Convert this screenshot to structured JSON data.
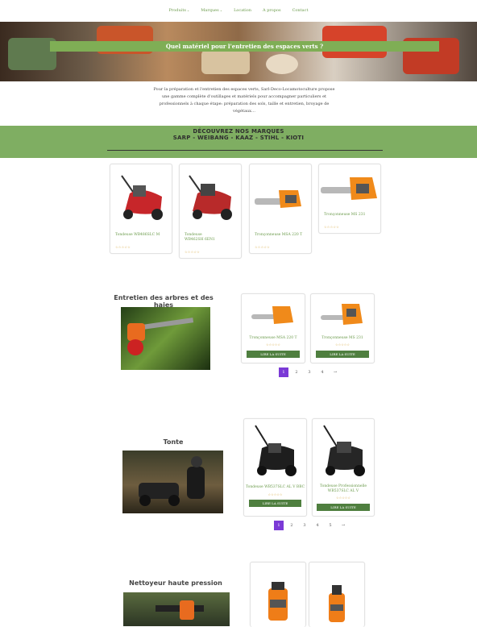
{
  "nav": {
    "items": [
      {
        "label": "Produits",
        "dropdown": true
      },
      {
        "label": "Marques",
        "dropdown": true
      },
      {
        "label": "Location",
        "dropdown": false
      },
      {
        "label": "A propos",
        "dropdown": false
      },
      {
        "label": "Contact",
        "dropdown": false
      }
    ]
  },
  "hero": {
    "title": "Quel matériel pour l'entretien des espaces verts ?"
  },
  "intro": {
    "text": "Pour la préparation et l'entretien des espaces verts, Sarl-Deco-Locamotoculture propose une gamme complète d'outillages et matériels pour accompagner particuliers et professionnels à chaque étape: préparation des sols, taille et entretien, broyage de végétaux…"
  },
  "brands": {
    "line1": "DÉCOUVREZ NOS MARQUES",
    "line2": "SARP - WEIBANG - KAAZ - STIHL - KIOTI"
  },
  "featured": [
    {
      "title": "Tondeuse WB486SLC M",
      "stars": "☆☆☆☆☆"
    },
    {
      "title": "Tondeuse WB462SH 6EN1",
      "stars": "☆☆☆☆☆"
    },
    {
      "title": "Tronçonneuse MSA 220 T",
      "stars": "☆☆☆☆☆"
    },
    {
      "title": "Tronçonneuse MS 231",
      "stars": "☆☆☆☆☆"
    }
  ],
  "sections": {
    "trees": {
      "title": "Entretien des arbres et des haies",
      "products": [
        {
          "name": "Tronçonneuse MSA 220 T",
          "stars": "☆☆☆☆☆",
          "button": "LIRE LA SUITE"
        },
        {
          "name": "Tronçonneuse MS 231",
          "stars": "☆☆☆☆☆",
          "button": "LIRE LA SUITE"
        }
      ],
      "pages": [
        "1",
        "2",
        "3",
        "4",
        "→"
      ]
    },
    "mowing": {
      "title": "Tonte",
      "products": [
        {
          "name": "Tondeuse WB537SLC AL V BBC",
          "stars": "☆☆☆☆☆",
          "button": "LIRE LA SUITE"
        },
        {
          "name": "Tondeuse Professionnelle WB537SLC AL V",
          "stars": "☆☆☆☆☆",
          "button": "LIRE LA SUITE"
        }
      ],
      "pages": [
        "1",
        "2",
        "3",
        "4",
        "5",
        "→"
      ]
    },
    "pressure": {
      "title": "Nettoyeur haute pression"
    }
  },
  "colors": {
    "accent": "#7fae55",
    "button": "#4f7f3f",
    "link": "#6a9a4a",
    "pagerActive": "#7b3ad6",
    "star": "#d4a43a"
  }
}
